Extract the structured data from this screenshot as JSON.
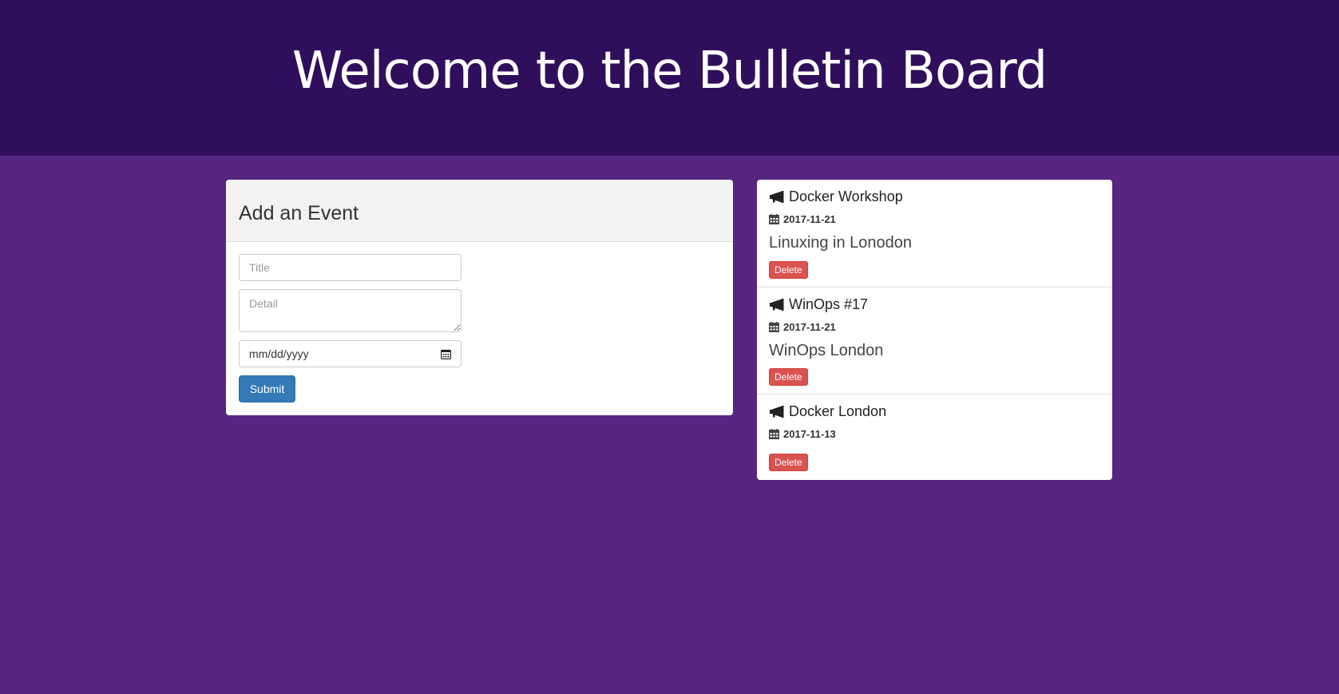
{
  "header": {
    "title": "Welcome to the Bulletin Board"
  },
  "form": {
    "heading": "Add an Event",
    "title_placeholder": "Title",
    "detail_placeholder": "Detail",
    "date_value": "mm/dd/yyyy",
    "submit_label": "Submit"
  },
  "events": [
    {
      "title": "Docker Workshop",
      "date": "2017-11-21",
      "detail": "Linuxing in Lonodon",
      "delete_label": "Delete"
    },
    {
      "title": "WinOps #17",
      "date": "2017-11-21",
      "detail": "WinOps London",
      "delete_label": "Delete"
    },
    {
      "title": "Docker London",
      "date": "2017-11-13",
      "detail": "",
      "delete_label": "Delete"
    }
  ],
  "icons": {
    "event": "bullhorn-icon",
    "date": "calendar-icon",
    "date_picker": "calendar-picker-icon"
  },
  "colors": {
    "header_bg": "#2f0f5b",
    "page_bg": "#55257f",
    "primary": "#337ab7",
    "danger": "#d9534f"
  }
}
